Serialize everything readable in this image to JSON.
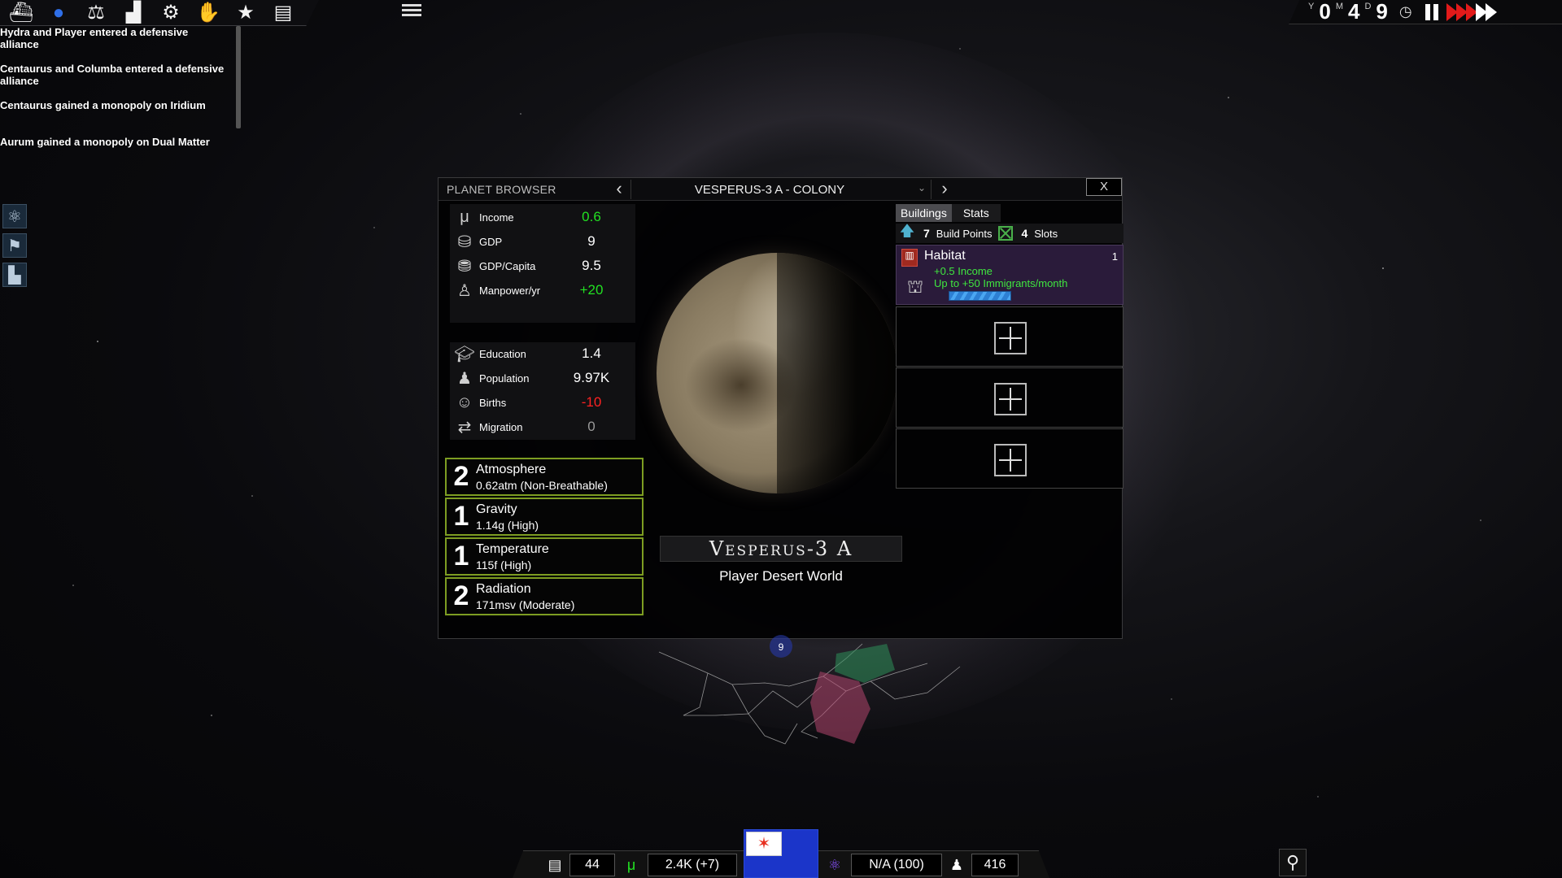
{
  "toolbar": {
    "icons": [
      "ships-icon",
      "planet-icon",
      "diplomacy-scales-icon",
      "economy-chart-icon",
      "settings-gear-icon",
      "trade-handshake-icon",
      "favorites-star-icon",
      "encyclopedia-book-icon"
    ]
  },
  "events": [
    "Hydra and Player entered a defensive alliance",
    "Centaurus and Columba entered a defensive alliance",
    "Centaurus gained a monopoly on Iridium",
    "Aurum gained a monopoly on Dual Matter"
  ],
  "date": {
    "y_label": "Y",
    "y_value": "0",
    "m_label": "M",
    "m_value": "4",
    "d_label": "D",
    "d_value": "9"
  },
  "planet_browser": {
    "title": "PLANET BROWSER",
    "selected_planet": "VESPERUS-3 A - COLONY",
    "close_label": "X",
    "economy": [
      {
        "label": "Income",
        "value": "0.6",
        "color": "#22e022"
      },
      {
        "label": "GDP",
        "value": "9"
      },
      {
        "label": "GDP/Capita",
        "value": "9.5"
      },
      {
        "label": "Manpower/yr",
        "value": "+20",
        "color": "#22e022"
      }
    ],
    "population": [
      {
        "label": "Education",
        "value": "1.4"
      },
      {
        "label": "Population",
        "value": "9.97K"
      },
      {
        "label": "Births",
        "value": "-10",
        "color": "#ff2222"
      },
      {
        "label": "Migration",
        "value": "0",
        "color": "#9a9a9a"
      }
    ],
    "environment": [
      {
        "num": "2",
        "name": "Atmosphere",
        "desc": "0.62atm (Non-Breathable)"
      },
      {
        "num": "1",
        "name": "Gravity",
        "desc": "1.14g (High)"
      },
      {
        "num": "1",
        "name": "Temperature",
        "desc": "115f (High)"
      },
      {
        "num": "2",
        "name": "Radiation",
        "desc": "171msv (Moderate)"
      }
    ],
    "planet_name": "Vesperus-3 A",
    "planet_type": "Player Desert World",
    "tabs": {
      "buildings": "Buildings",
      "stats": "Stats"
    },
    "build_points": {
      "value": "7",
      "label": "Build Points",
      "slots_value": "4",
      "slots_label": "Slots"
    },
    "habitat": {
      "name": "Habitat",
      "count": "1",
      "line1": "+0.5 Income",
      "line2": "Up to +50 Immigrants/month",
      "progress": 0.45
    }
  },
  "galaxy_label": "9",
  "bottom_bar": {
    "research_value": "44",
    "money_value": "2.4K (+7)",
    "science_value": "N/A (100)",
    "manpower_value": "416"
  },
  "colors": {
    "env_border": "#7d9d22",
    "positive": "#22e022",
    "negative": "#ff2222",
    "flag_blue": "#1b35c9",
    "habitat_bg": "#2a1b3a"
  }
}
